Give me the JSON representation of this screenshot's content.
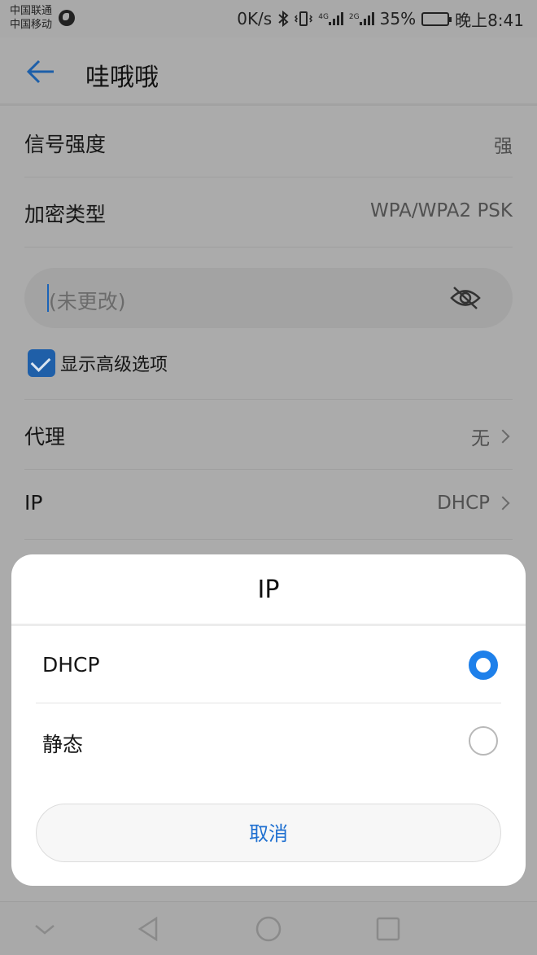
{
  "status_bar": {
    "carrier_1": "中国联通",
    "carrier_2": "中国移动",
    "net_speed": "0K/s",
    "network_1": "4G",
    "network_2": "2G",
    "battery_percent": "35%",
    "time": "晚上8:41",
    "battery_level": 0.35
  },
  "header": {
    "title": "哇哦哦"
  },
  "details": {
    "signal_label": "信号强度",
    "signal_value": "强",
    "security_label": "加密类型",
    "security_value": "WPA/WPA2 PSK"
  },
  "password": {
    "placeholder": "(未更改)"
  },
  "advanced": {
    "label": "显示高级选项",
    "checked": true
  },
  "proxy": {
    "label": "代理",
    "value": "无"
  },
  "ip": {
    "label": "IP",
    "value": "DHCP"
  },
  "dialog": {
    "title": "IP",
    "options": [
      {
        "label": "DHCP",
        "selected": true
      },
      {
        "label": "静态",
        "selected": false
      }
    ],
    "cancel_label": "取消"
  },
  "colors": {
    "accent": "#1e80ea",
    "dim_background": "#ababab"
  },
  "icons": [
    "globe-icon",
    "bluetooth-icon",
    "vibrate-icon",
    "signal-icon",
    "battery-icon",
    "back-arrow-icon",
    "eye-off-icon",
    "checkbox-icon",
    "chevron-right-icon",
    "nav-down-icon",
    "nav-back-icon",
    "nav-home-icon",
    "nav-recents-icon"
  ]
}
